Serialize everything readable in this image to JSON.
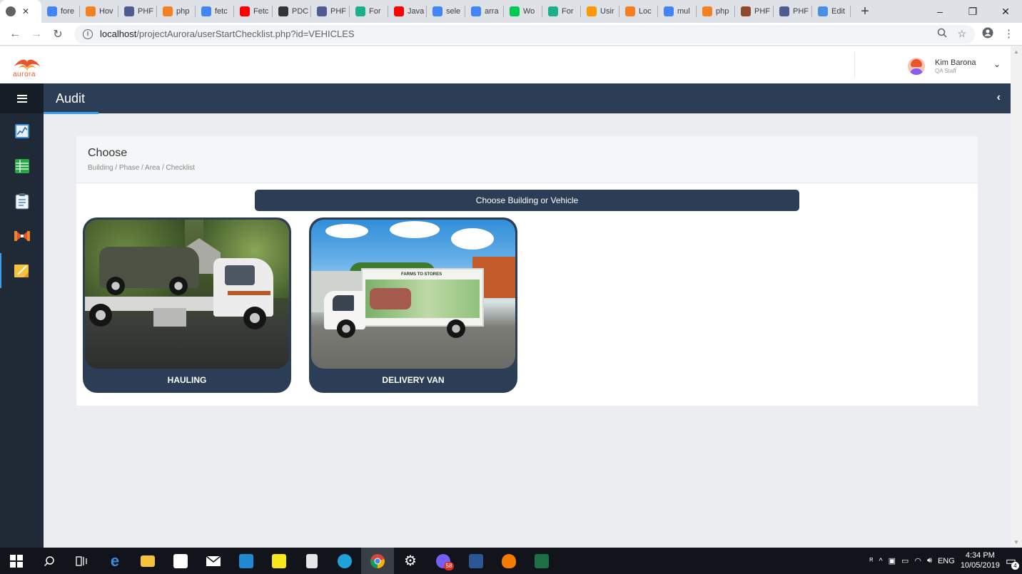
{
  "browser": {
    "active_tab": {
      "title": "",
      "favicon": "globe-icon"
    },
    "tabs": [
      {
        "label": "fore",
        "favicon": "google-icon",
        "color": "#4285f4"
      },
      {
        "label": "Hov",
        "favicon": "stackoverflow-icon",
        "color": "#f48024"
      },
      {
        "label": "PHF",
        "favicon": "php-icon",
        "color": "#4f5b93"
      },
      {
        "label": "php",
        "favicon": "stackoverflow-icon",
        "color": "#f48024"
      },
      {
        "label": "fetc",
        "favicon": "google-icon",
        "color": "#4285f4"
      },
      {
        "label": "Fetc",
        "favicon": "youtube-icon",
        "color": "#ff0000"
      },
      {
        "label": "PDC",
        "favicon": "pdo-icon",
        "color": "#333333"
      },
      {
        "label": "PHF",
        "favicon": "php-icon",
        "color": "#4f5b93"
      },
      {
        "label": "For",
        "favicon": "forum-icon",
        "color": "#1aaf8b"
      },
      {
        "label": "Java",
        "favicon": "youtube-icon",
        "color": "#ff0000"
      },
      {
        "label": "sele",
        "favicon": "google-icon",
        "color": "#4285f4"
      },
      {
        "label": "arra",
        "favicon": "google-icon",
        "color": "#4285f4"
      },
      {
        "label": "Wo",
        "favicon": "wo-icon",
        "color": "#00c853"
      },
      {
        "label": "For",
        "favicon": "forum-icon",
        "color": "#1aaf8b"
      },
      {
        "label": "Usir",
        "favicon": "blogger-icon",
        "color": "#ff9800"
      },
      {
        "label": "Loc",
        "favicon": "stackoverflow-icon",
        "color": "#f48024"
      },
      {
        "label": "mul",
        "favicon": "google-icon",
        "color": "#4285f4"
      },
      {
        "label": "php",
        "favicon": "stackoverflow-icon",
        "color": "#f48024"
      },
      {
        "label": "PHF",
        "favicon": "books-icon",
        "color": "#8e4a2a"
      },
      {
        "label": "PHF",
        "favicon": "php-icon",
        "color": "#4f5b93"
      },
      {
        "label": "Edit",
        "favicon": "cloud-icon",
        "color": "#4a90e2"
      }
    ],
    "url_host": "localhost",
    "url_path": "/projectAurora/userStartChecklist.php?id=VEHICLES"
  },
  "app": {
    "logo_text": "aurora",
    "user": {
      "name": "Kim Barona",
      "role": "QA Staff"
    },
    "topbar_title": "Audit",
    "card": {
      "title": "Choose",
      "breadcrumb": "Building / Phase / Area / Checklist",
      "choose_button": "Choose Building or Vehicle"
    },
    "tiles": [
      {
        "label": "HAULING"
      },
      {
        "label": "DELIVERY VAN"
      }
    ],
    "van_text": "FARMS TO STORES",
    "sidebar_icons": [
      "chart-icon",
      "spreadsheet-icon",
      "clipboard-icon",
      "bowtie-icon",
      "sticky-note-icon"
    ]
  },
  "taskbar": {
    "time": "4:34 PM",
    "date": "10/05/2019",
    "language": "ENG",
    "viber_badge": "58",
    "notification_count": "4"
  }
}
